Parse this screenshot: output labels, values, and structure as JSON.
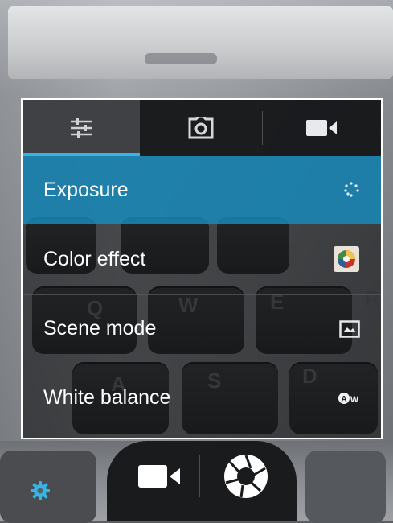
{
  "tabs": [
    {
      "icon": "sliders-icon",
      "active": true
    },
    {
      "icon": "camera-icon",
      "active": false
    },
    {
      "icon": "video-camera-icon",
      "active": false
    }
  ],
  "menu": [
    {
      "label": "Exposure",
      "icon": "exposure-icon",
      "selected": true
    },
    {
      "label": "Color effect",
      "icon": "color-effect-icon",
      "selected": false
    },
    {
      "label": "Scene mode",
      "icon": "scene-mode-icon",
      "selected": false
    },
    {
      "label": "White balance",
      "icon": "white-balance-auto-icon",
      "selected": false
    }
  ],
  "bottom": {
    "modes": [
      {
        "icon": "video-mode-icon"
      },
      {
        "icon": "shutter-icon"
      }
    ],
    "settings_icon": "settings-dot-icon"
  },
  "colors": {
    "accent": "#33b5e5",
    "selected_row": "#178cbe",
    "popup_border": "#ffffff"
  },
  "background_letters": [
    "Q",
    "W",
    "E",
    "R",
    "S",
    "D",
    "A"
  ]
}
